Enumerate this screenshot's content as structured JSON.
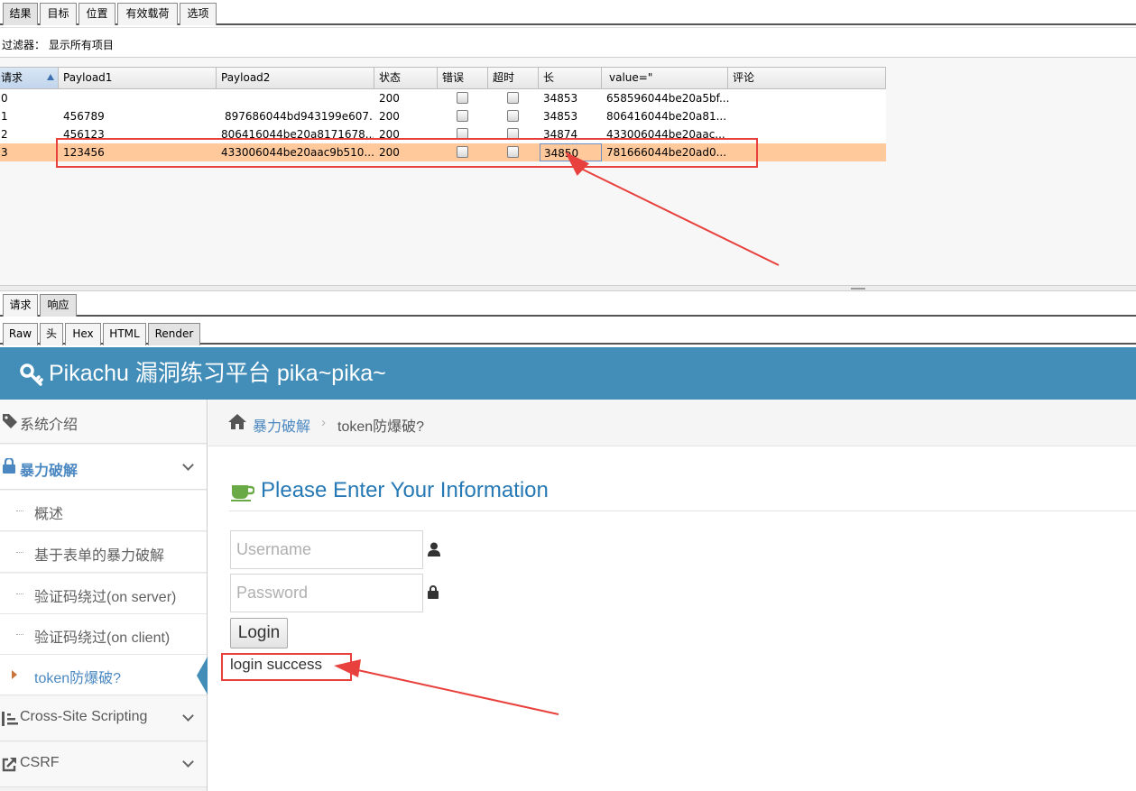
{
  "top_tabs": [
    "结果",
    "目标",
    "位置",
    "有效载荷",
    "选项"
  ],
  "filter_text": "过滤器： 显示所有项目",
  "table": {
    "headers": [
      "请求",
      "Payload1",
      "Payload2",
      "状态",
      "错误",
      "超时",
      "长",
      "value=\"",
      "评论"
    ],
    "rows": [
      {
        "req": "0",
        "p1": "",
        "p2": "",
        "status": "200",
        "length": "34853",
        "value": "658596044be20a5bf..."
      },
      {
        "req": "1",
        "p1": "456789",
        "p2": "897686044bd943199e607...",
        "status": "200",
        "length": "34853",
        "value": "806416044be20a81..."
      },
      {
        "req": "2",
        "p1": "456123",
        "p2": "806416044be20a8171678...",
        "status": "200",
        "length": "34874",
        "value": "433006044be20aac..."
      },
      {
        "req": "3",
        "p1": "123456",
        "p2": "433006044be20aac9b510...",
        "status": "200",
        "length": "34850",
        "value": "781666044be20ad0..."
      }
    ],
    "selected_row": 3
  },
  "req_tabs": [
    "请求",
    "响应"
  ],
  "view_tabs": [
    "Raw",
    "头",
    "Hex",
    "HTML",
    "Render"
  ],
  "page": {
    "brand": "Pikachu 漏洞练习平台 pika~pika~",
    "sidebar": {
      "intro": "系统介绍",
      "brute": "暴力破解",
      "sub_items": [
        "概述",
        "基于表单的暴力破解",
        "验证码绕过(on server)",
        "验证码绕过(on client)",
        "token防爆破?"
      ],
      "xss": "Cross-Site Scripting",
      "csrf": "CSRF"
    },
    "breadcrumb": {
      "parent": "暴力破解",
      "current": "token防爆破?"
    },
    "title": "Please Enter Your Information",
    "username_placeholder": "Username",
    "password_placeholder": "Password",
    "login_label": "Login",
    "result": "login success"
  },
  "colors": {
    "navbar": "#438eb9",
    "selected_row": "#ffc99c",
    "annotation": "#e8403c",
    "link": "#4b88c1"
  }
}
